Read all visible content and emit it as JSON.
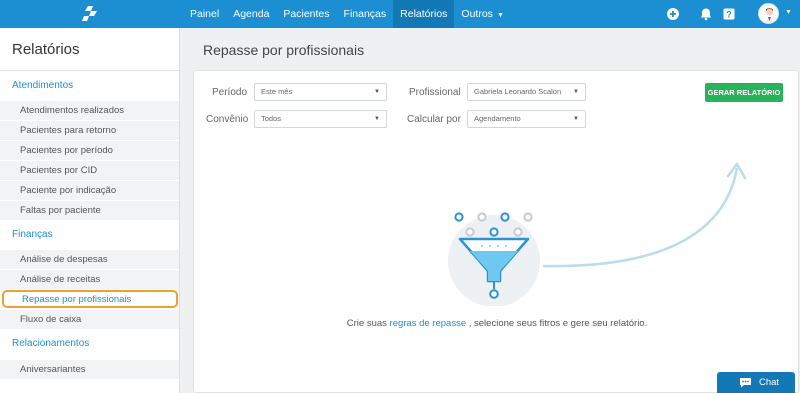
{
  "nav": {
    "items": [
      {
        "label": "Painel"
      },
      {
        "label": "Agenda"
      },
      {
        "label": "Pacientes"
      },
      {
        "label": "Finanças"
      },
      {
        "label": "Relatórios",
        "active": true
      },
      {
        "label": "Outros"
      }
    ],
    "brand_color": "#1b8fd2",
    "active_color": "#1278b6",
    "icons": [
      "plus-circle-icon",
      "bell-icon",
      "help-icon"
    ]
  },
  "sidebar": {
    "title": "Relatórios",
    "sections": [
      {
        "title": "Atendimentos",
        "items": [
          "Atendimentos realizados",
          "Pacientes para retorno",
          "Pacientes por período",
          "Pacientes por CID",
          "Paciente por indicação",
          "Faltas por paciente"
        ]
      },
      {
        "title": "Finanças",
        "items": [
          "Análise de despesas",
          "Análise de receitas",
          "Repasse por profissionais",
          "Fluxo de caixa"
        ]
      },
      {
        "title": "Relacionamentos",
        "items": [
          "Aniversariantes"
        ]
      }
    ],
    "active_item": "Repasse por profissionais",
    "highlight_color": "#f0a030"
  },
  "main": {
    "title": "Repasse por profissionais",
    "filters": {
      "periodo": {
        "label": "Período",
        "value": "Este mês"
      },
      "profissional": {
        "label": "Profissional",
        "value": "Gabriela Leonardo Scalon"
      },
      "convenio": {
        "label": "Convênio",
        "value": "Todos"
      },
      "calcular": {
        "label": "Calcular por",
        "value": "Agendamento"
      }
    },
    "generate_button": "GERAR RELATÓRIO",
    "button_color": "#27b35a",
    "empty": {
      "before": "Crie suas",
      "link": "regras de repasse",
      "after": ", selecione seus fitros e gere seu relatório."
    }
  },
  "chat": {
    "label": "Chat"
  }
}
